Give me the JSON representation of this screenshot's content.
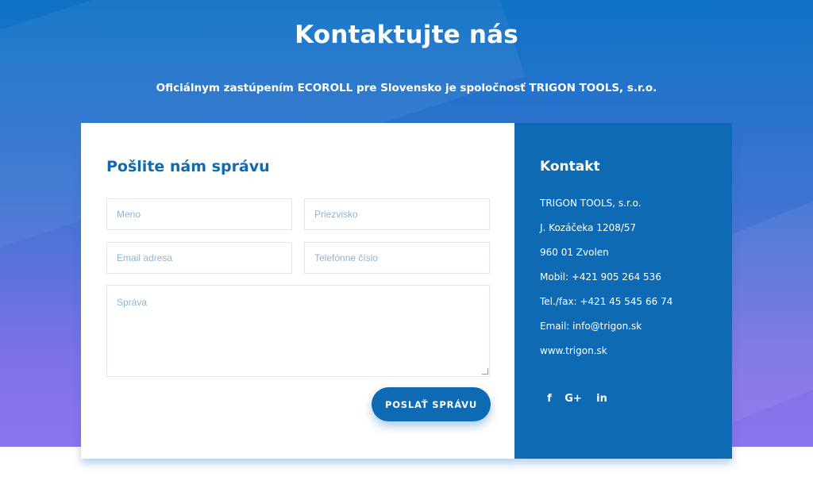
{
  "hero": {
    "title": "Kontaktujte nás",
    "subtitle": "Oficiálnym zastúpením ECOROLL pre Slovensko je spoločnosť TRIGON TOOLS, s.r.o."
  },
  "form": {
    "title": "Pošlite nám správu",
    "first_name_placeholder": "Meno",
    "last_name_placeholder": "Priezvisko",
    "email_placeholder": "Email adresa",
    "phone_placeholder": "Telefónne číslo",
    "message_placeholder": "Správa",
    "submit_label": "POSLAŤ SPRÁVU"
  },
  "contact": {
    "title": "Kontakt",
    "lines": [
      "TRIGON TOOLS, s.r.o.",
      "J. Kozáčeka 1208/57",
      "960 01 Zvolen",
      "Mobil: +421 905 264 536",
      "Tel./fax: +421 45 545 66 74",
      "Email: info@trigon.sk",
      "www.trigon.sk"
    ],
    "socials": [
      {
        "icon": "facebook-icon",
        "glyph": "f"
      },
      {
        "icon": "google-plus-icon",
        "glyph": "G+"
      },
      {
        "icon": "linkedin-icon",
        "glyph": "in"
      }
    ]
  },
  "colors": {
    "primary": "#0f6ab4",
    "gradient_top": "#0f72c6",
    "gradient_bottom": "#8c74ec"
  }
}
